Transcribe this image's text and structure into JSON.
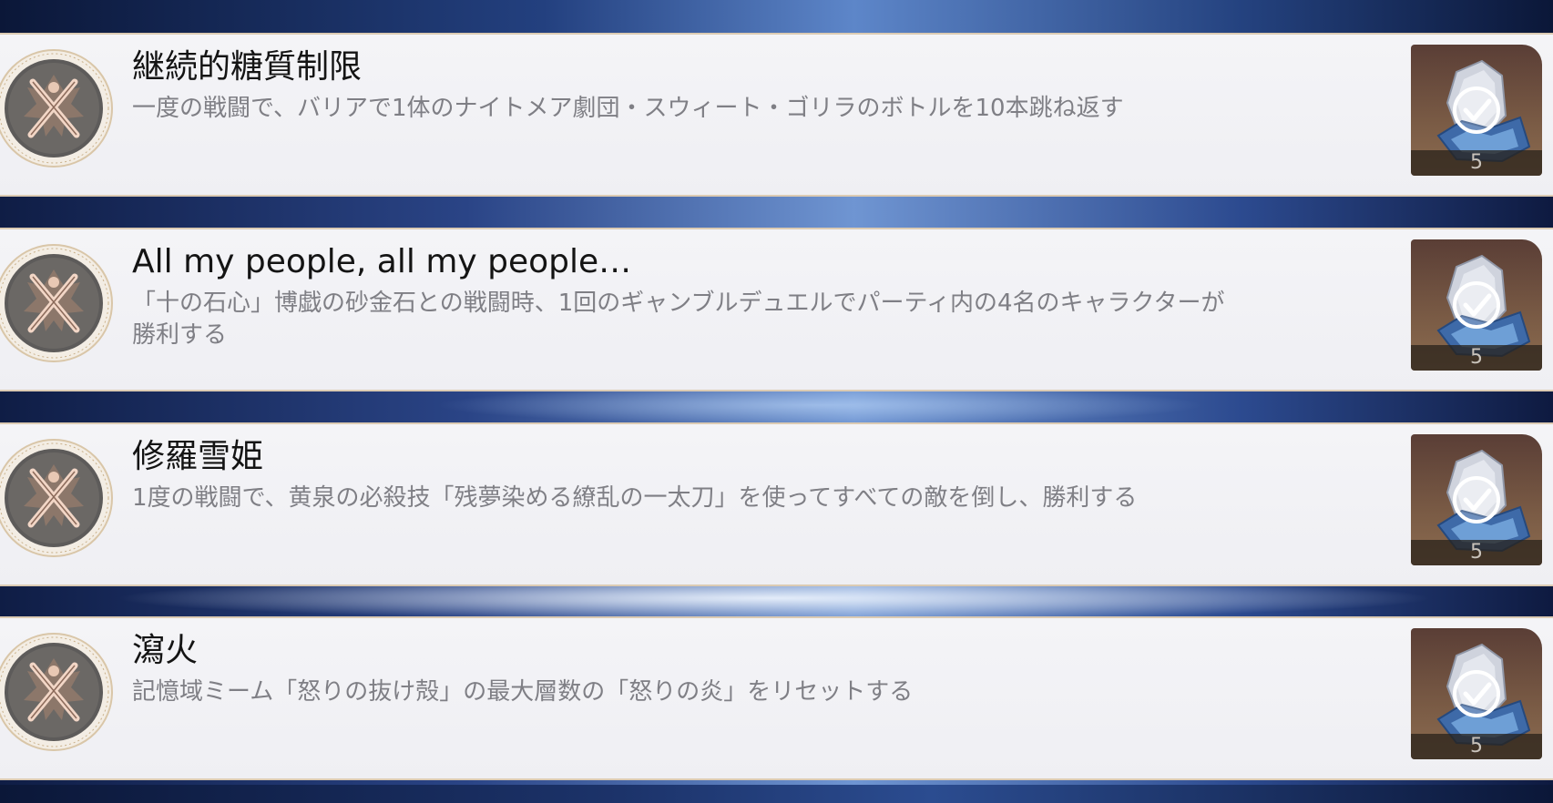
{
  "achievements": [
    {
      "title": "継続的糖質制限",
      "description": "一度の戦闘で、バリアで1体のナイトメア劇団・スウィート・ゴリラのボトルを10本跳ね返す",
      "reward_qty": "5",
      "completed": true
    },
    {
      "title": "All my people, all my people…",
      "description": "「十の石心」博戯の砂金石との戦闘時、1回のギャンブルデュエルでパーティ内の4名のキャラクターが勝利する",
      "reward_qty": "5",
      "completed": true
    },
    {
      "title": "修羅雪姫",
      "description": "1度の戦闘で、黄泉の必殺技「残夢染める繚乱の一太刀」を使ってすべての敵を倒し、勝利する",
      "reward_qty": "5",
      "completed": true
    },
    {
      "title": "瀉火",
      "description": "記憶域ミーム「怒りの抜け殻」の最大層数の「怒りの炎」をリセットする",
      "reward_qty": "5",
      "completed": true
    }
  ],
  "icons": {
    "emblem": "achievement-emblem-icon",
    "reward": "stellar-jade-icon",
    "check": "check-icon"
  },
  "colors": {
    "card_bg": "#f2f2f5",
    "card_border": "#dccbb3",
    "title": "#141414",
    "description": "#7f7f85",
    "band_blue": "#2a4486"
  }
}
